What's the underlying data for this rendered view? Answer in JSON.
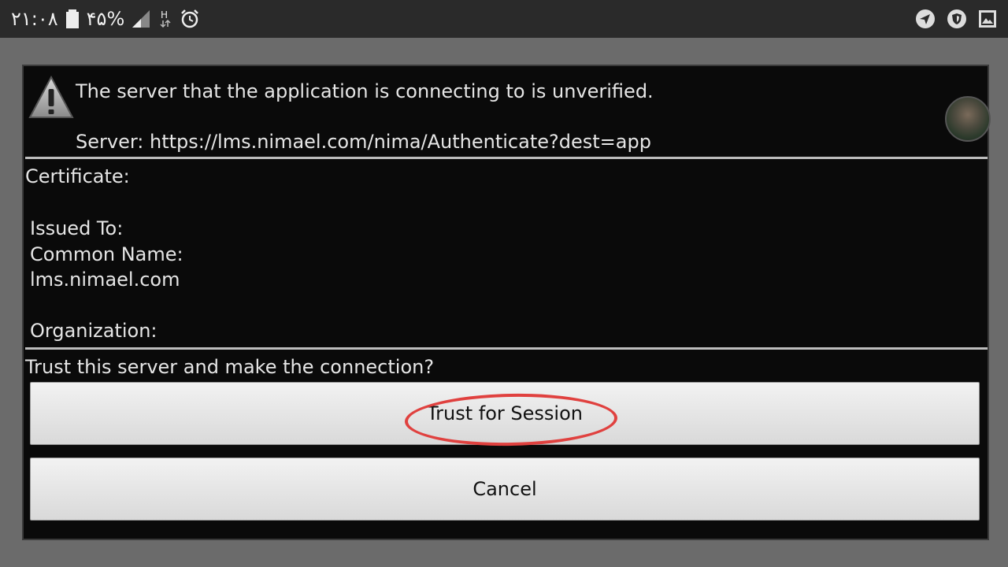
{
  "status_bar": {
    "time": "۲۱:۰۸",
    "battery_percent": "۴۵%",
    "network_indicator": "H",
    "icons": [
      "battery-icon",
      "signal-icon",
      "network-h-icon",
      "alarm-icon",
      "send-icon",
      "shield-icon",
      "gallery-icon"
    ]
  },
  "dialog": {
    "message": "The server that the application is connecting to is unverified.",
    "server_line": "Server: https://lms.nimael.com/nima/Authenticate?dest=app",
    "certificate_label": "Certificate:",
    "issued_to_label": "Issued To:",
    "common_name_label": "Common Name:",
    "common_name_value": "lms.nimael.com",
    "organization_label": "Organization:",
    "question": "Trust this server and make the connection?",
    "trust_button": "Trust for Session",
    "cancel_button": "Cancel"
  },
  "colors": {
    "dialog_background": "#0a0a0a",
    "overlay_background": "#6b6b6b",
    "annotation_ring": "#e0413f",
    "divider": "#bdbdbd"
  }
}
